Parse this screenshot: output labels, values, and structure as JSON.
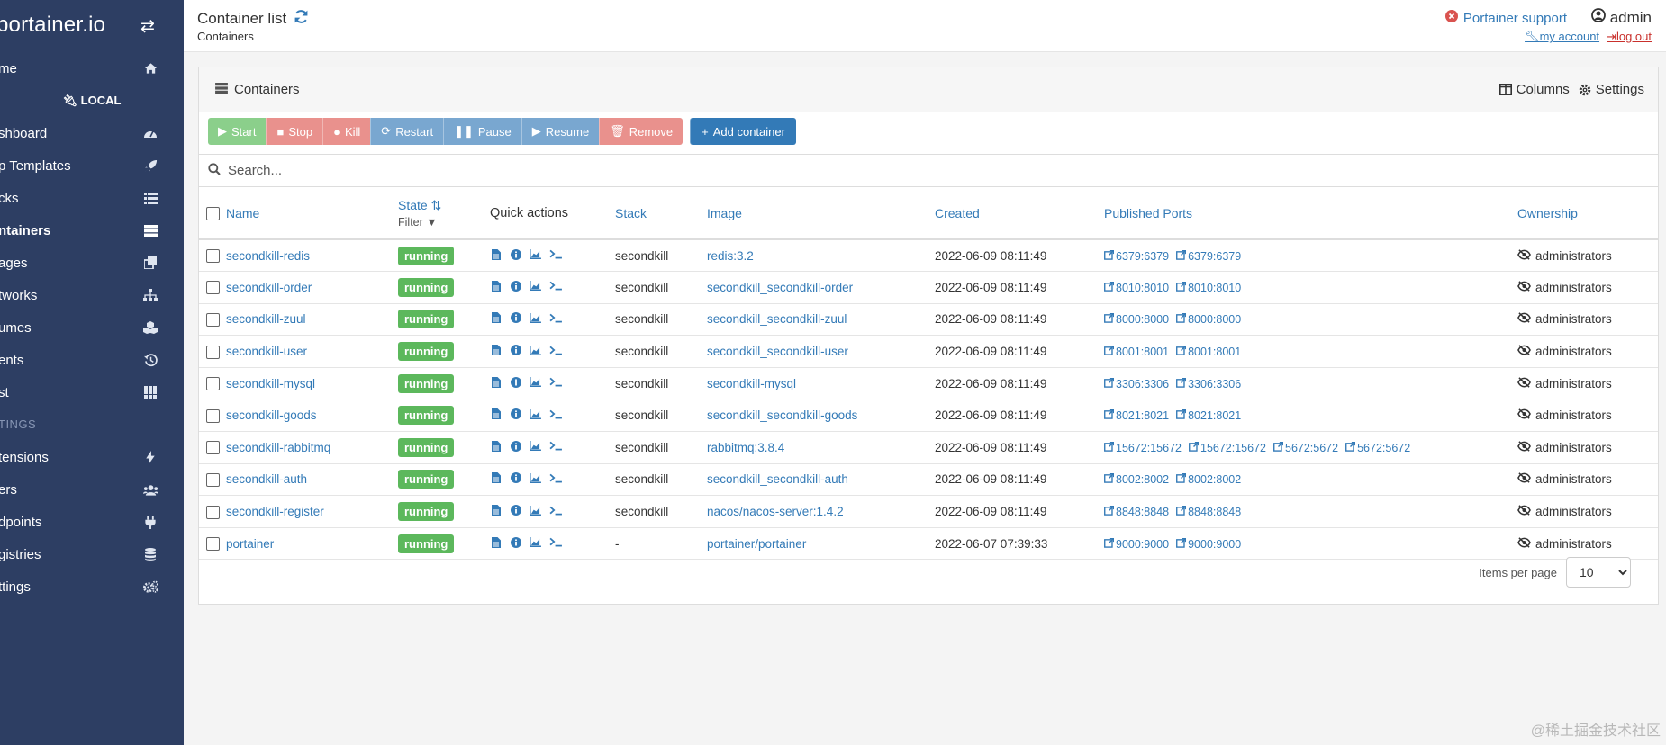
{
  "sidebar": {
    "brand": "portainer.io",
    "endpoint_label": "LOCAL",
    "section_label": "TINGS",
    "items": [
      {
        "label": "me",
        "icon": "home-icon"
      },
      {
        "label": "shboard",
        "icon": "dashboard-icon"
      },
      {
        "label": "p Templates",
        "icon": "rocket-icon"
      },
      {
        "label": "cks",
        "icon": "stacks-icon"
      },
      {
        "label": "ntainers",
        "icon": "server-icon"
      },
      {
        "label": "ages",
        "icon": "clone-icon"
      },
      {
        "label": "tworks",
        "icon": "sitemap-icon"
      },
      {
        "label": "umes",
        "icon": "cubes-icon"
      },
      {
        "label": "ents",
        "icon": "history-icon"
      },
      {
        "label": "st",
        "icon": "th-icon"
      },
      {
        "label": "tensions",
        "icon": "bolt-icon"
      },
      {
        "label": "ers",
        "icon": "users-icon"
      },
      {
        "label": "dpoints",
        "icon": "plug-icon"
      },
      {
        "label": "gistries",
        "icon": "database-icon"
      },
      {
        "label": "ttings",
        "icon": "cogs-icon"
      }
    ]
  },
  "header": {
    "title": "Container list",
    "breadcrumb": "Containers",
    "support": "Portainer support",
    "user": "admin",
    "my_account": "my account",
    "log_out": "log out"
  },
  "panel": {
    "title": "Containers",
    "columns_label": "Columns",
    "settings_label": "Settings"
  },
  "actions": {
    "start": "Start",
    "stop": "Stop",
    "kill": "Kill",
    "restart": "Restart",
    "pause": "Pause",
    "resume": "Resume",
    "remove": "Remove",
    "add": "Add container"
  },
  "search": {
    "placeholder": "Search..."
  },
  "table": {
    "headers": {
      "name": "Name",
      "state": "State",
      "filter": "Filter",
      "quick_actions": "Quick actions",
      "stack": "Stack",
      "image": "Image",
      "created": "Created",
      "ports": "Published Ports",
      "ownership": "Ownership"
    },
    "rows": [
      {
        "name": "secondkill-redis",
        "state": "running",
        "stack": "secondkill",
        "image": "redis:3.2",
        "created": "2022-06-09 08:11:49",
        "ports": [
          "6379:6379",
          "6379:6379"
        ],
        "ownership": "administrators"
      },
      {
        "name": "secondkill-order",
        "state": "running",
        "stack": "secondkill",
        "image": "secondkill_secondkill-order",
        "created": "2022-06-09 08:11:49",
        "ports": [
          "8010:8010",
          "8010:8010"
        ],
        "ownership": "administrators"
      },
      {
        "name": "secondkill-zuul",
        "state": "running",
        "stack": "secondkill",
        "image": "secondkill_secondkill-zuul",
        "created": "2022-06-09 08:11:49",
        "ports": [
          "8000:8000",
          "8000:8000"
        ],
        "ownership": "administrators"
      },
      {
        "name": "secondkill-user",
        "state": "running",
        "stack": "secondkill",
        "image": "secondkill_secondkill-user",
        "created": "2022-06-09 08:11:49",
        "ports": [
          "8001:8001",
          "8001:8001"
        ],
        "ownership": "administrators"
      },
      {
        "name": "secondkill-mysql",
        "state": "running",
        "stack": "secondkill",
        "image": "secondkill-mysql",
        "created": "2022-06-09 08:11:49",
        "ports": [
          "3306:3306",
          "3306:3306"
        ],
        "ownership": "administrators"
      },
      {
        "name": "secondkill-goods",
        "state": "running",
        "stack": "secondkill",
        "image": "secondkill_secondkill-goods",
        "created": "2022-06-09 08:11:49",
        "ports": [
          "8021:8021",
          "8021:8021"
        ],
        "ownership": "administrators"
      },
      {
        "name": "secondkill-rabbitmq",
        "state": "running",
        "stack": "secondkill",
        "image": "rabbitmq:3.8.4",
        "created": "2022-06-09 08:11:49",
        "ports": [
          "15672:15672",
          "15672:15672",
          "5672:5672",
          "5672:5672"
        ],
        "ownership": "administrators"
      },
      {
        "name": "secondkill-auth",
        "state": "running",
        "stack": "secondkill",
        "image": "secondkill_secondkill-auth",
        "created": "2022-06-09 08:11:49",
        "ports": [
          "8002:8002",
          "8002:8002"
        ],
        "ownership": "administrators"
      },
      {
        "name": "secondkill-register",
        "state": "running",
        "stack": "secondkill",
        "image": "nacos/nacos-server:1.4.2",
        "created": "2022-06-09 08:11:49",
        "ports": [
          "8848:8848",
          "8848:8848"
        ],
        "ownership": "administrators"
      },
      {
        "name": "portainer",
        "state": "running",
        "stack": "-",
        "image": "portainer/portainer",
        "created": "2022-06-07 07:39:33",
        "ports": [
          "9000:9000",
          "9000:9000"
        ],
        "ownership": "administrators"
      }
    ]
  },
  "pagination": {
    "label": "Items per page",
    "value": "10"
  },
  "watermark": "@稀土掘金技术社区",
  "colors": {
    "sidebar": "#2d3e63",
    "link": "#337ab7",
    "running": "#5cb85c"
  }
}
